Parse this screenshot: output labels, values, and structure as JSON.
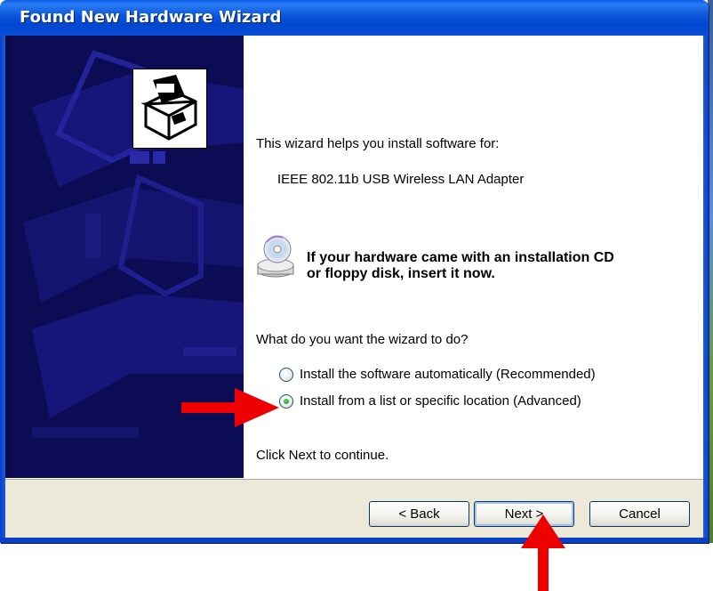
{
  "window": {
    "title": "Found New Hardware Wizard"
  },
  "content": {
    "intro": "This wizard helps you install software for:",
    "device_name": "IEEE 802.11b USB Wireless LAN Adapter",
    "cd_prompt_line1": "If your hardware came with an installation CD",
    "cd_prompt_line2": "or floppy disk, insert it now.",
    "question": "What do you want the wizard to do?",
    "options": [
      {
        "label": "Install the software automatically (Recommended)",
        "selected": false
      },
      {
        "label": "Install from a list or specific location (Advanced)",
        "selected": true
      }
    ],
    "continue_hint": "Click Next to continue."
  },
  "buttons": {
    "back": "< Back",
    "next": "Next >",
    "cancel": "Cancel"
  },
  "icons": {
    "hardware": "hardware-install-icon",
    "cd": "cd-drive-icon",
    "annotation": "red-arrow-icon"
  },
  "colors": {
    "titlebar": "#0a54d9",
    "side_panel": "#0c0c54",
    "footer": "#ece9d8",
    "annotation_arrow": "#ee0000"
  }
}
